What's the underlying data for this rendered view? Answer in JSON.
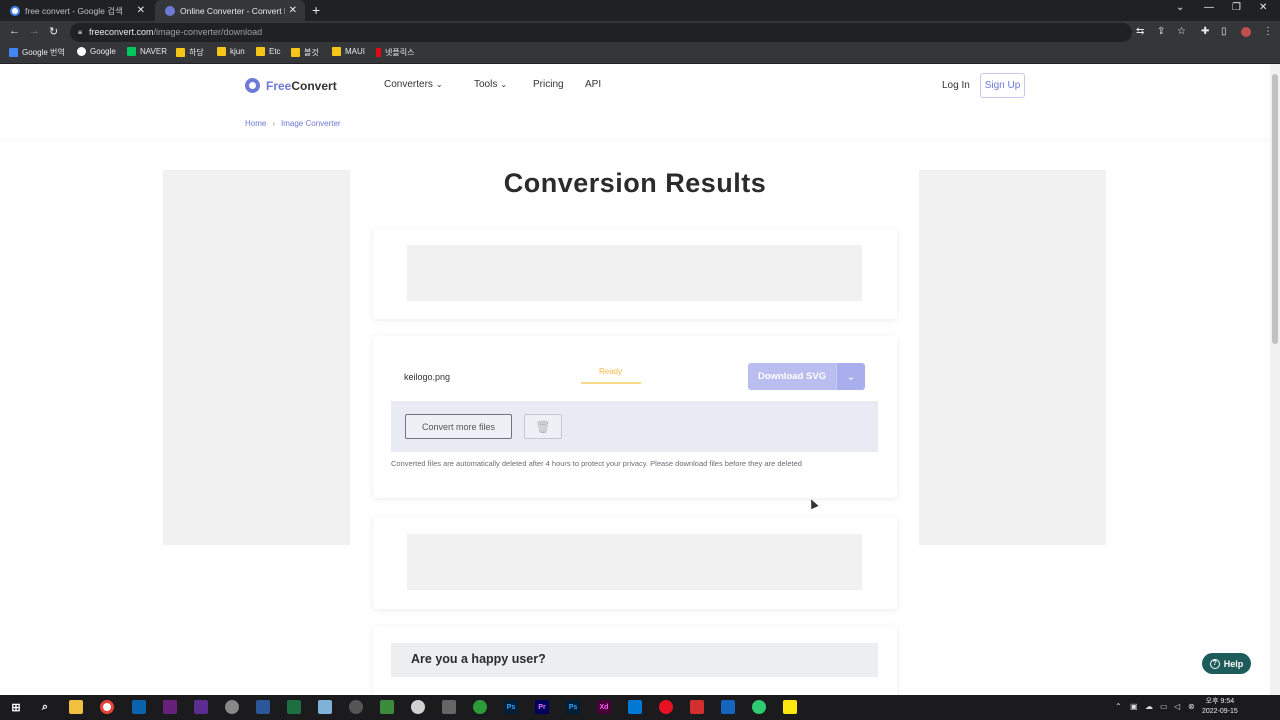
{
  "browser": {
    "tabs": [
      {
        "title": "free convert - Google 검색",
        "favicon_color": "#4285f4"
      },
      {
        "title": "Online Converter - Convert Ima",
        "favicon_color": "#6e79d8"
      }
    ],
    "new_tab": "+",
    "window_controls": {
      "min": "—",
      "restore": "❐",
      "close": "✕"
    },
    "url": {
      "host": "freeconvert.com",
      "path": "/image-converter/download"
    },
    "bookmarks": [
      {
        "label": "Google 번역",
        "color": "#4285f4"
      },
      {
        "label": "Google",
        "color": "#ea4335"
      },
      {
        "label": "NAVER",
        "color": "#03c75a"
      },
      {
        "label": "하당",
        "color": "#f5c518"
      },
      {
        "label": "kjun",
        "color": "#f5c518"
      },
      {
        "label": "Etc",
        "color": "#f5c518"
      },
      {
        "label": "볼것",
        "color": "#f5c518"
      },
      {
        "label": "MAUI",
        "color": "#f5c518"
      },
      {
        "label": "넷플릭스",
        "color": "#e50914"
      }
    ]
  },
  "site": {
    "logo": {
      "free": "Free",
      "convert": "Convert"
    },
    "nav": {
      "converters": "Converters",
      "tools": "Tools",
      "pricing": "Pricing",
      "api": "API"
    },
    "login": "Log In",
    "signup": "Sign Up",
    "breadcrumb": {
      "home": "Home",
      "current": "Image Converter"
    }
  },
  "main": {
    "heading": "Conversion Results",
    "file": {
      "name": "keilogo.png",
      "status": "Ready",
      "download_label": "Download SVG"
    },
    "convert_more": "Convert more files",
    "notice": "Converted files are automatically deleted after 4 hours to protect your privacy. Please download files before they are deleted",
    "happy_title": "Are you a happy user?",
    "help": "Help"
  },
  "taskbar": {
    "clock_time": "오후 9:54",
    "clock_date": "2022-09-15"
  },
  "colors": {
    "accent": "#6e79d8",
    "download_button": "#b9bdf0",
    "status_ready": "#f5b942",
    "help_button": "#1d5c5a"
  }
}
